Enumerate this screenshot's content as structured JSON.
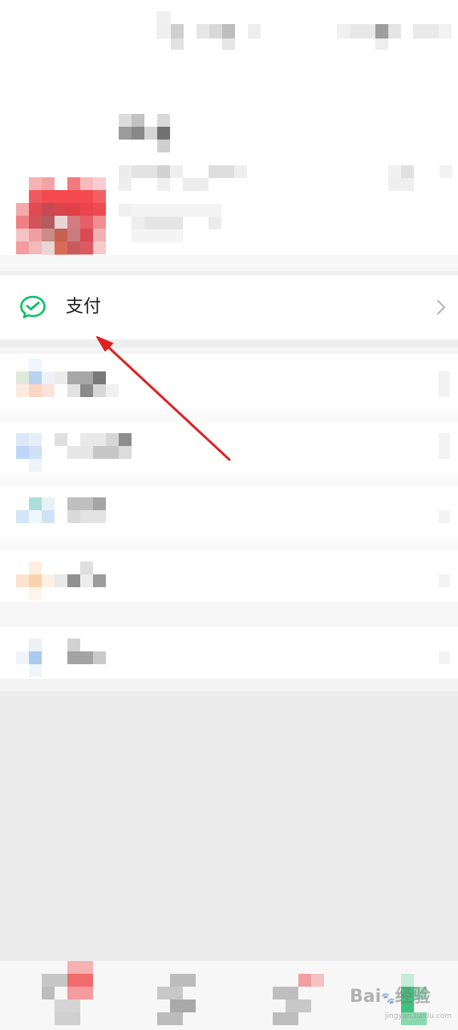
{
  "pay": {
    "label": "支付",
    "icon": "wechat-pay-icon",
    "icon_color": "#07c160"
  },
  "colors": {
    "background": "#ffffff",
    "separator": "#f1f1f1",
    "empty_area": "#ececec",
    "annotation_arrow": "#e02020"
  },
  "watermark": {
    "text": "Bai",
    "suffix": "经验",
    "site": "jingyan.baidu.com"
  }
}
